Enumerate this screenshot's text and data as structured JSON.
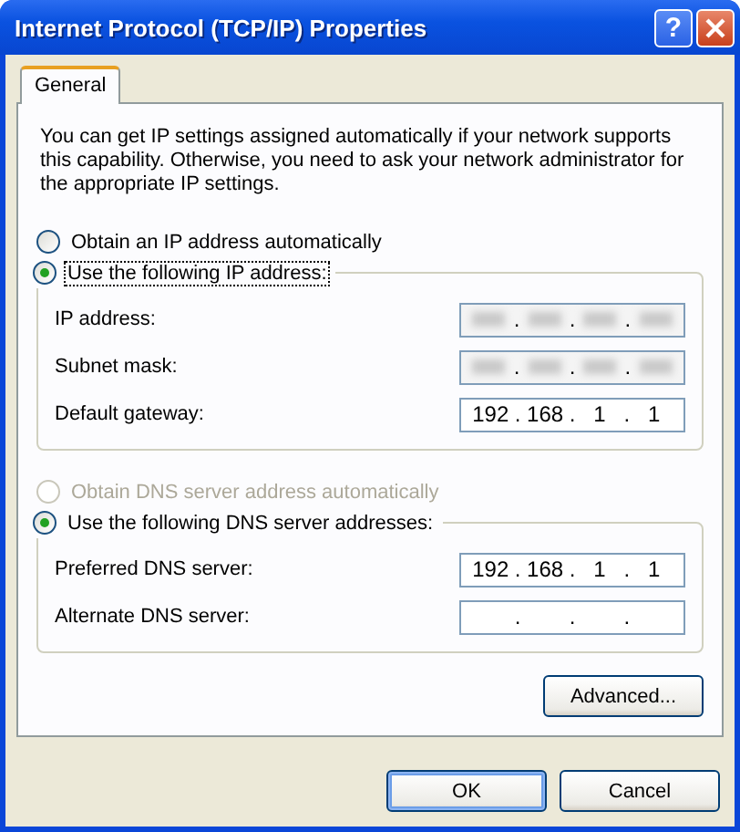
{
  "window": {
    "title": "Internet Protocol (TCP/IP) Properties"
  },
  "title_buttons": [
    {
      "kind": "help",
      "label": "?"
    },
    {
      "kind": "close"
    }
  ],
  "tabs": [
    {
      "label": "General",
      "selected": true
    }
  ],
  "description": "You can get IP settings assigned automatically if your network supports this capability. Otherwise, you need to ask your network administrator for the appropriate IP settings.",
  "ip_options": [
    {
      "label": "Obtain an IP address automatically",
      "selected": false,
      "disabled": false,
      "focused": false
    },
    {
      "label": "Use the following IP address:",
      "selected": true,
      "disabled": false,
      "focused": true
    }
  ],
  "ip_fields": [
    {
      "label": "IP address:",
      "separator": ".",
      "redacted": true
    },
    {
      "label": "Subnet mask:",
      "separator": ".",
      "redacted": true
    },
    {
      "label": "Default gateway:",
      "separator": ".",
      "redacted": false,
      "octets": [
        "192",
        "168",
        "1",
        "1"
      ]
    }
  ],
  "dns_options": [
    {
      "label": "Obtain DNS server address automatically",
      "selected": false,
      "disabled": true,
      "focused": false
    },
    {
      "label": "Use the following DNS server addresses:",
      "selected": true,
      "disabled": false,
      "focused": false
    }
  ],
  "dns_fields": [
    {
      "label": "Preferred DNS server:",
      "separator": ".",
      "redacted": false,
      "octets": [
        "192",
        "168",
        "1",
        "1"
      ]
    },
    {
      "label": "Alternate DNS server:",
      "separator": ".",
      "redacted": false
    }
  ],
  "advanced_button": {
    "label": "Advanced..."
  },
  "buttons": [
    {
      "label": "OK",
      "default": true
    },
    {
      "label": "Cancel",
      "default": false
    }
  ]
}
